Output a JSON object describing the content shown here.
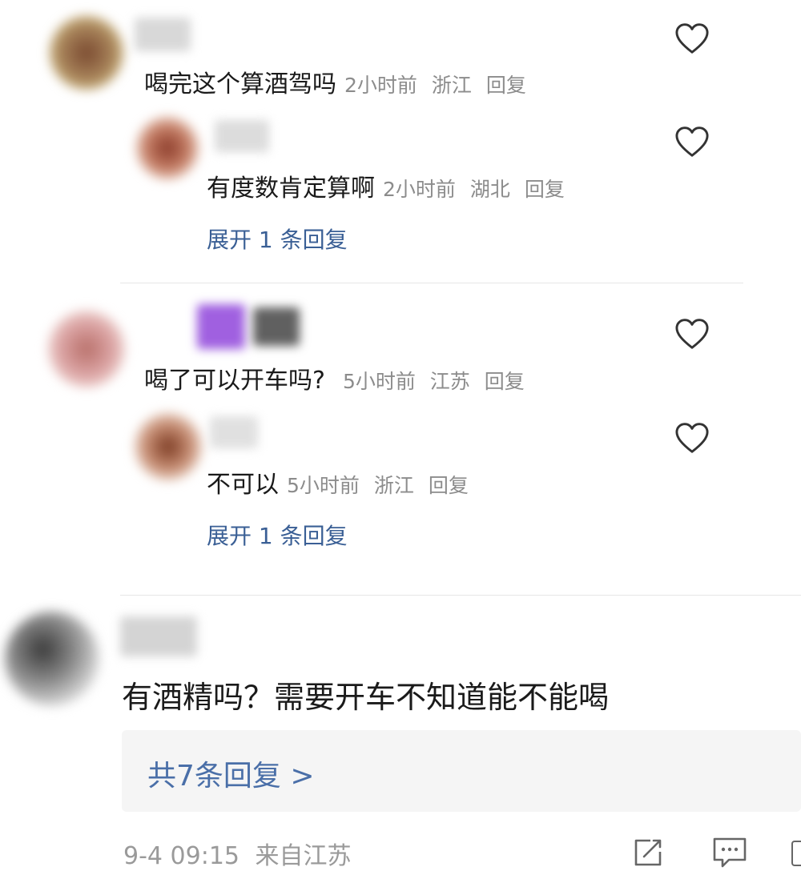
{
  "comments": [
    {
      "text": "喝完这个算酒驾吗",
      "time": "2小时前",
      "location": "浙江",
      "reply_label": "回复",
      "replies": [
        {
          "text": "有度数肯定算啊",
          "time": "2小时前",
          "location": "湖北",
          "reply_label": "回复"
        }
      ],
      "expand_label": "展开 1 条回复"
    },
    {
      "text": "喝了可以开车吗?",
      "time": "5小时前",
      "location": "江苏",
      "reply_label": "回复",
      "replies": [
        {
          "text": "不可以",
          "time": "5小时前",
          "location": "浙江",
          "reply_label": "回复"
        }
      ],
      "expand_label": "展开 1 条回复"
    }
  ],
  "post": {
    "comment_text": "有酒精吗？需要开车不知道能不能喝",
    "replies_link": "共7条回复 >",
    "footer_time": "9-4 09:15",
    "footer_source": "来自江苏"
  },
  "icons": {
    "like": "heart-outline-icon",
    "share": "share-icon",
    "comment": "comment-icon"
  },
  "colors": {
    "link": "#3a5f95",
    "meta": "#8c8c8c",
    "reply_box_bg": "#f5f5f5"
  }
}
